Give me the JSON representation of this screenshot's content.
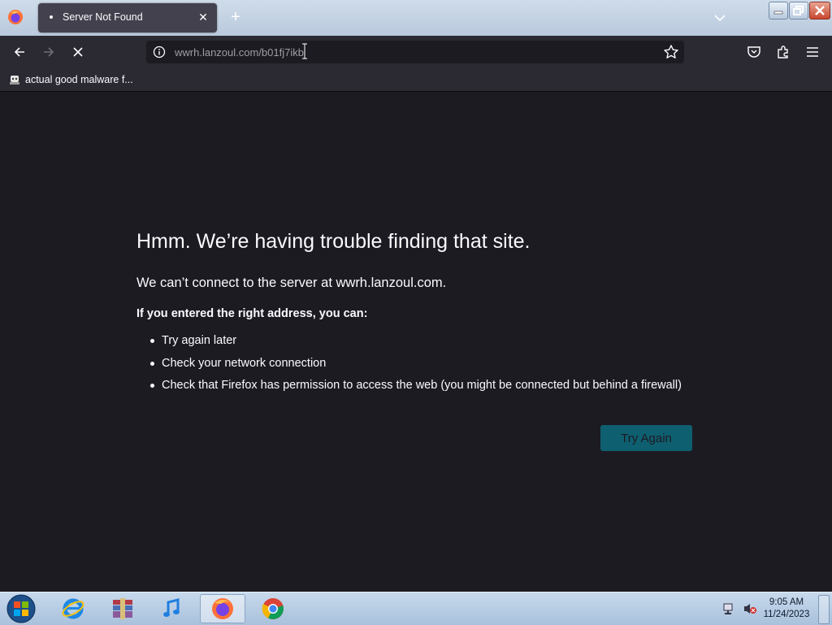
{
  "browser": {
    "tab": {
      "title": "Server Not Found"
    },
    "url": "wwrh.lanzoul.com/b01fj7ikb",
    "bookmark": {
      "label": "actual good malware f..."
    }
  },
  "page": {
    "title": "Hmm. We’re having trouble finding that site.",
    "short_desc": "We can’t connect to the server at wwrh.lanzoul.com.",
    "long_desc": "If you entered the right address, you can:",
    "suggestions": [
      "Try again later",
      "Check your network connection",
      "Check that Firefox has permission to access the web (you might be connected but behind a firewall)"
    ],
    "try_again_label": "Try Again"
  },
  "taskbar": {
    "apps": [
      "internet-explorer-icon",
      "archive-app-icon",
      "itunes-icon",
      "firefox-icon",
      "chrome-icon"
    ],
    "time": "9:05 AM",
    "date": "11/24/2023"
  },
  "colors": {
    "page_bg": "#1c1b22",
    "toolbar_bg": "#2b2a33",
    "button_accent": "#0e5f70"
  }
}
